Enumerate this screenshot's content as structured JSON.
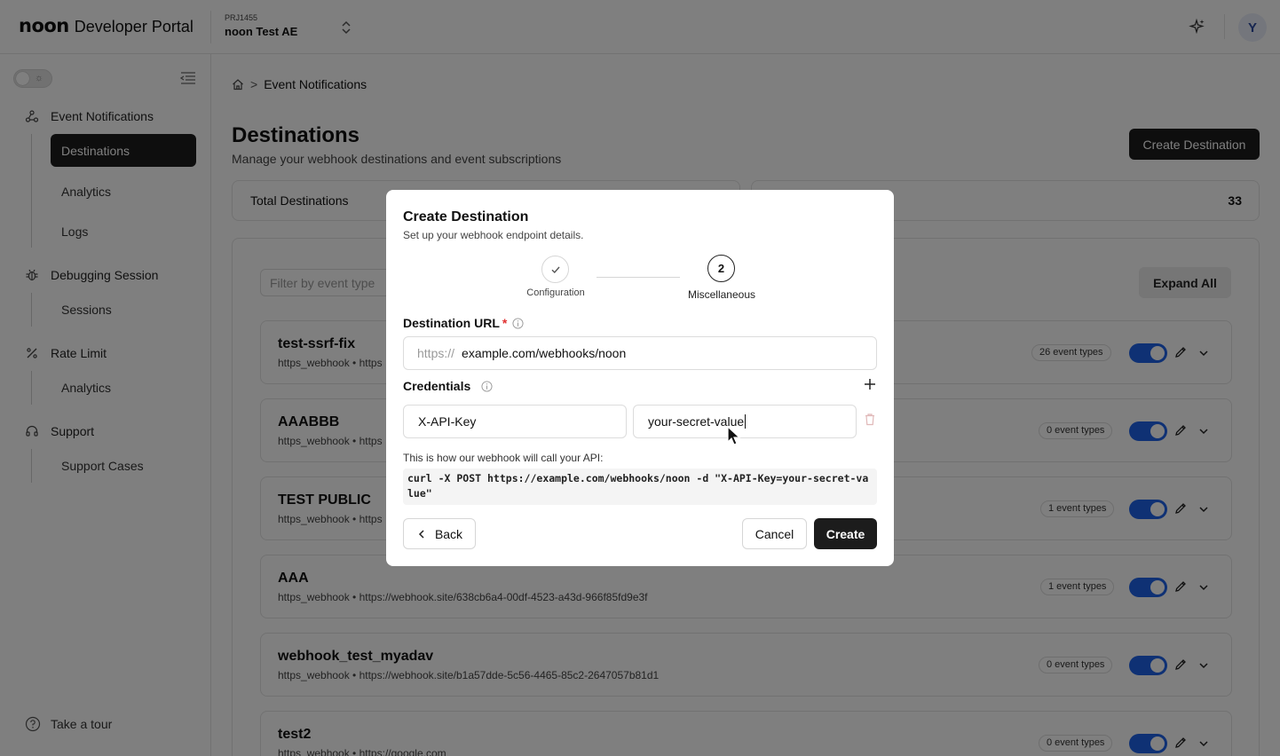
{
  "header": {
    "logo_mark": "noon",
    "logo_text": "Developer Portal",
    "project_code": "PRJ1455",
    "project_name": "noon Test AE",
    "avatar_initial": "Y"
  },
  "sidebar": {
    "sections": [
      {
        "label": "Event Notifications",
        "icon": "webhook-icon",
        "items": [
          "Destinations",
          "Analytics",
          "Logs"
        ]
      },
      {
        "label": "Debugging Session",
        "icon": "bug-icon",
        "items": [
          "Sessions"
        ]
      },
      {
        "label": "Rate Limit",
        "icon": "percent-icon",
        "items": [
          "Analytics"
        ]
      },
      {
        "label": "Support",
        "icon": "headset-icon",
        "items": [
          "Support Cases"
        ]
      }
    ],
    "active_item": "Destinations",
    "tour_label": "Take a tour"
  },
  "main": {
    "breadcrumb_sep": ">",
    "breadcrumb_current": "Event Notifications",
    "title": "Destinations",
    "subtitle": "Manage your webhook destinations and event subscriptions",
    "create_button": "Create Destination",
    "stats": {
      "total_label": "Total Destinations",
      "right_value": "33"
    },
    "filter_placeholder": "Filter by event type",
    "expand_all": "Expand All",
    "destinations": [
      {
        "name": "test-ssrf-fix",
        "meta": "https_webhook • https",
        "events": "26 event types"
      },
      {
        "name": "AAABBB",
        "meta": "https_webhook • https",
        "events": "0 event types"
      },
      {
        "name": "TEST PUBLIC",
        "meta": "https_webhook • https",
        "events": "1 event types"
      },
      {
        "name": "AAA",
        "meta": "https_webhook • https://webhook.site/638cb6a4-00df-4523-a43d-966f85fd9e3f",
        "events": "1 event types"
      },
      {
        "name": "webhook_test_myadav",
        "meta": "https_webhook • https://webhook.site/b1a57dde-5c56-4465-85c2-2647057b81d1",
        "events": "0 event types"
      },
      {
        "name": "test2",
        "meta": "https_webhook • https://google.com",
        "events": "0 event types"
      }
    ]
  },
  "modal": {
    "title": "Create Destination",
    "subtitle": "Set up your webhook endpoint details.",
    "steps": [
      {
        "label": "Configuration",
        "state": "done"
      },
      {
        "label": "Miscellaneous",
        "number": "2",
        "state": "current"
      }
    ],
    "url_label": "Destination URL",
    "required_mark": "*",
    "url_prefix": "https://",
    "url_value": "example.com/webhooks/noon",
    "credentials_label": "Credentials",
    "credential_key": "X-API-Key",
    "credential_value": "your-secret-value",
    "hint": "This is how our webhook will call your API:",
    "curl": "curl -X POST https://example.com/webhooks/noon -d \"X-API-Key=your-secret-value\"",
    "back": "Back",
    "cancel": "Cancel",
    "create": "Create"
  },
  "colors": {
    "accent": "#1e63e9",
    "dark": "#1c1c1c",
    "required": "#e03131"
  }
}
